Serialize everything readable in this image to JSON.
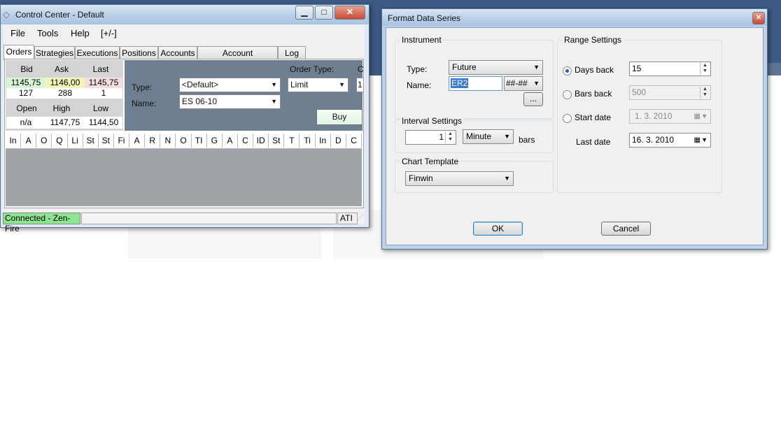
{
  "control_center": {
    "title": "Control Center - Default",
    "menu": [
      "File",
      "Tools",
      "Help",
      "[+/-]"
    ],
    "tabs": [
      "Orders",
      "Strategies",
      "Executions",
      "Positions",
      "Accounts",
      "Account Performance",
      "Log"
    ],
    "quote": {
      "headers1": [
        "Bid",
        "Ask",
        "Last"
      ],
      "values1": [
        "1145,75",
        "1146,00",
        "1145,75"
      ],
      "sizes": [
        "127",
        "288",
        "1"
      ],
      "headers2": [
        "Open",
        "High",
        "Low"
      ],
      "values2": [
        "n/a",
        "1147,75",
        "1144,50"
      ]
    },
    "order_entry": {
      "type_label": "Type:",
      "type_value": "<Default>",
      "name_label": "Name:",
      "name_value": "ES 06-10",
      "order_type_label": "Order Type:",
      "order_type_value": "Limit",
      "cut_label": "C",
      "cut_value": "1",
      "buy_label": "Buy"
    },
    "columns": [
      "In",
      "A",
      "O",
      "Q",
      "Li",
      "St",
      "St",
      "Fi",
      "A",
      "R",
      "N",
      "O",
      "TI",
      "G",
      "A",
      "C",
      "ID",
      "St",
      "T",
      "Ti",
      "In",
      "D",
      "C"
    ],
    "status": {
      "connection": "Connected - Zen-Fire",
      "right": "ATI"
    }
  },
  "dialog": {
    "title": "Format Data Series",
    "instrument": {
      "group_label": "Instrument",
      "type_label": "Type:",
      "type_value": "Future",
      "name_label": "Name:",
      "name_value": "ER2",
      "expiry_value": "##-##",
      "browse_label": "..."
    },
    "interval": {
      "group_label": "Interval Settings",
      "value": "1",
      "unit": "Minute",
      "suffix": "bars"
    },
    "chart_template": {
      "group_label": "Chart Template",
      "value": "Finwin"
    },
    "range": {
      "group_label": "Range Settings",
      "days_back_label": "Days back",
      "days_back_value": "15",
      "bars_back_label": "Bars back",
      "bars_back_value": "500",
      "start_date_label": "Start date",
      "start_date_value": "1.  3. 2010",
      "last_date_label": "Last date",
      "last_date_value": "16.  3. 2010",
      "selected": "Days back"
    },
    "buttons": {
      "ok": "OK",
      "cancel": "Cancel"
    }
  },
  "colors": {
    "accent_blue": "#2a5bb5",
    "status_green": "#8fe48f",
    "panel_gray": "#a0a4a8",
    "order_panel": "#6d7f90"
  }
}
